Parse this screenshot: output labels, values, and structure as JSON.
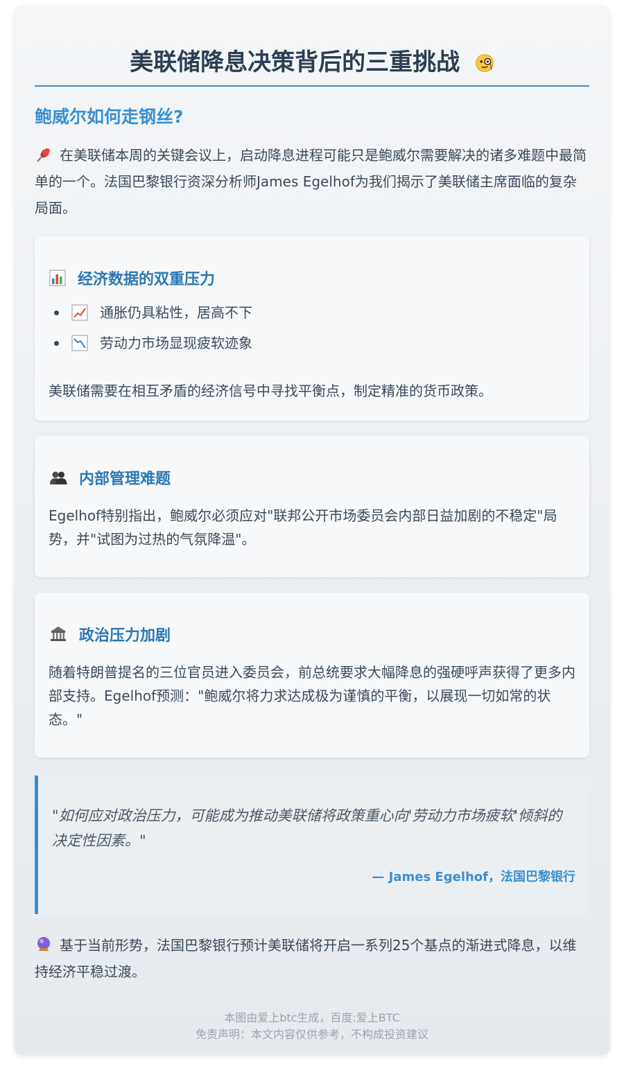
{
  "header": {
    "title": "美联储降息决策背后的三重挑战",
    "title_icon": "monocle-face-icon"
  },
  "subtitle": "鲍威尔如何走钢丝?",
  "intro": {
    "icon": "pushpin-icon",
    "text": "在美联储本周的关键会议上，启动降息进程可能只是鲍威尔需要解决的诸多难题中最简单的一个。法国巴黎银行资深分析师James Egelhof为我们揭示了美联储主席面临的复杂局面。"
  },
  "sections": [
    {
      "icon": "bar-chart-icon",
      "title": "经济数据的双重压力",
      "items": [
        {
          "icon": "chart-increasing-icon",
          "text": "通胀仍具粘性，居高不下"
        },
        {
          "icon": "chart-decreasing-icon",
          "text": "劳动力市场显现疲软迹象"
        }
      ],
      "body": "美联储需要在相互矛盾的经济信号中寻找平衡点，制定精准的货币政策。"
    },
    {
      "icon": "busts-in-silhouette-icon",
      "title": "内部管理难题",
      "body": "Egelhof特别指出，鲍威尔必须应对\"联邦公开市场委员会内部日益加剧的不稳定\"局势，并\"试图为过热的气氛降温\"。"
    },
    {
      "icon": "classical-building-icon",
      "title": "政治压力加剧",
      "body": "随着特朗普提名的三位官员进入委员会，前总统要求大幅降息的强硬呼声获得了更多内部支持。Egelhof预测：\"鲍威尔将力求达成极为谨慎的平衡，以展现一切如常的状态。\""
    }
  ],
  "quote": {
    "text": "\"如何应对政治压力，可能成为推动美联储将政策重心向'劳动力市场疲软'倾斜的决定性因素。\"",
    "source": "— James Egelhof，法国巴黎银行"
  },
  "outro": {
    "icon": "crystal-ball-icon",
    "text": "基于当前形势，法国巴黎银行预计美联储将开启一系列25个基点的渐进式降息，以维持经济平稳过渡。"
  },
  "footer": {
    "line1": "本图由爱上btc生成，百度:爱上BTC",
    "line2": "免责声明：本文内容仅供参考，不构成投资建议"
  }
}
